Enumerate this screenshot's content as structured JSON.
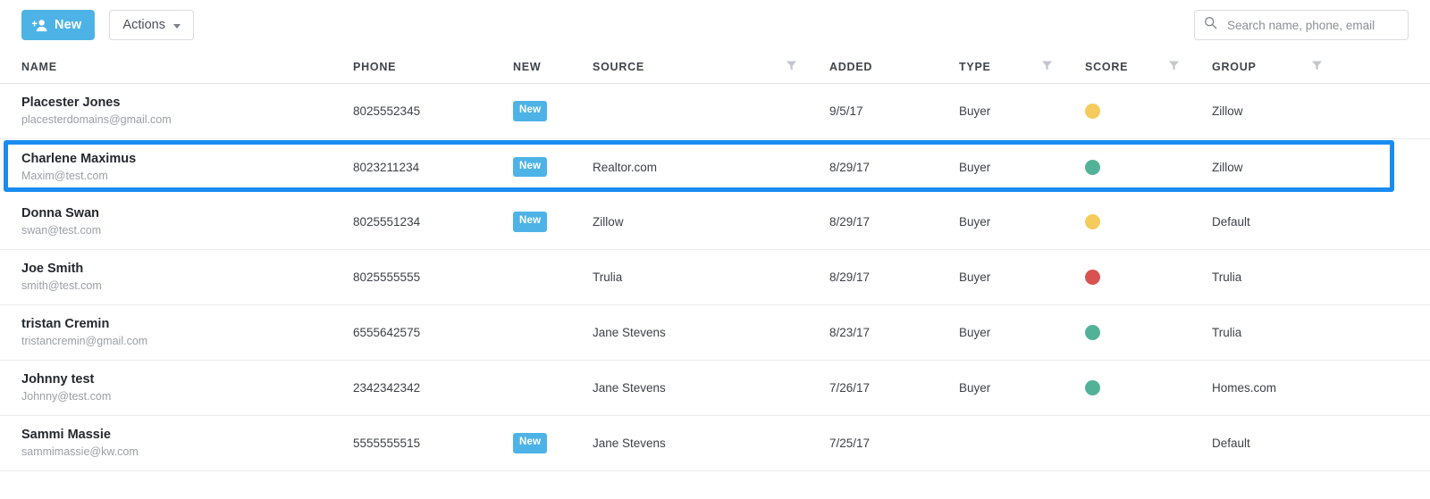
{
  "toolbar": {
    "new_label": "New",
    "actions_label": "Actions",
    "new_icon": "add-person-icon",
    "caret_icon": "chevron-down-icon",
    "accent_color": "#4db3e6"
  },
  "search": {
    "placeholder": "Search name, phone, email",
    "value": "",
    "icon": "search-icon"
  },
  "table": {
    "columns": [
      {
        "key": "name",
        "label": "NAME",
        "filter": false
      },
      {
        "key": "phone",
        "label": "PHONE",
        "filter": false
      },
      {
        "key": "new",
        "label": "NEW",
        "filter": false
      },
      {
        "key": "source",
        "label": "SOURCE",
        "filter": true
      },
      {
        "key": "added",
        "label": "ADDED",
        "filter": false
      },
      {
        "key": "type",
        "label": "TYPE",
        "filter": true
      },
      {
        "key": "score",
        "label": "SCORE",
        "filter": true
      },
      {
        "key": "group",
        "label": "GROUP",
        "filter": true
      }
    ],
    "rows": [
      {
        "name": "Placester Jones",
        "email": "placesterdomains@gmail.com",
        "phone": "8025552345",
        "new": "New",
        "source": "",
        "added": "9/5/17",
        "type": "Buyer",
        "score": "#f4cb5c",
        "group": "Zillow",
        "highlighted": false
      },
      {
        "name": "Charlene Maximus",
        "email": "Maxim@test.com",
        "phone": "8023211234",
        "new": "New",
        "source": "Realtor.com",
        "added": "8/29/17",
        "type": "Buyer",
        "score": "#52b297",
        "group": "Zillow",
        "highlighted": true
      },
      {
        "name": "Donna Swan",
        "email": "swan@test.com",
        "phone": "8025551234",
        "new": "New",
        "source": "Zillow",
        "added": "8/29/17",
        "type": "Buyer",
        "score": "#f4cb5c",
        "group": "Default",
        "highlighted": false
      },
      {
        "name": "Joe Smith",
        "email": "smith@test.com",
        "phone": "8025555555",
        "new": "",
        "source": "Trulia",
        "added": "8/29/17",
        "type": "Buyer",
        "score": "#d8534f",
        "group": "Trulia",
        "highlighted": false
      },
      {
        "name": "tristan Cremin",
        "email": "tristancremin@gmail.com",
        "phone": "6555642575",
        "new": "",
        "source": "Jane Stevens",
        "added": "8/23/17",
        "type": "Buyer",
        "score": "#52b297",
        "group": "Trulia",
        "highlighted": false
      },
      {
        "name": "Johnny test",
        "email": "Johnny@test.com",
        "phone": "2342342342",
        "new": "",
        "source": "Jane Stevens",
        "added": "7/26/17",
        "type": "Buyer",
        "score": "#52b297",
        "group": "Homes.com",
        "highlighted": false
      },
      {
        "name": "Sammi Massie",
        "email": "sammimassie@kw.com",
        "phone": "5555555515",
        "new": "New",
        "source": "Jane Stevens",
        "added": "7/25/17",
        "type": "",
        "score": "",
        "group": "Default",
        "highlighted": false
      }
    ]
  },
  "colors": {
    "highlight_border": "#1a8cf0",
    "badge": "#4db3e6",
    "score_green": "#52b297",
    "score_yellow": "#f4cb5c",
    "score_red": "#d8534f"
  }
}
